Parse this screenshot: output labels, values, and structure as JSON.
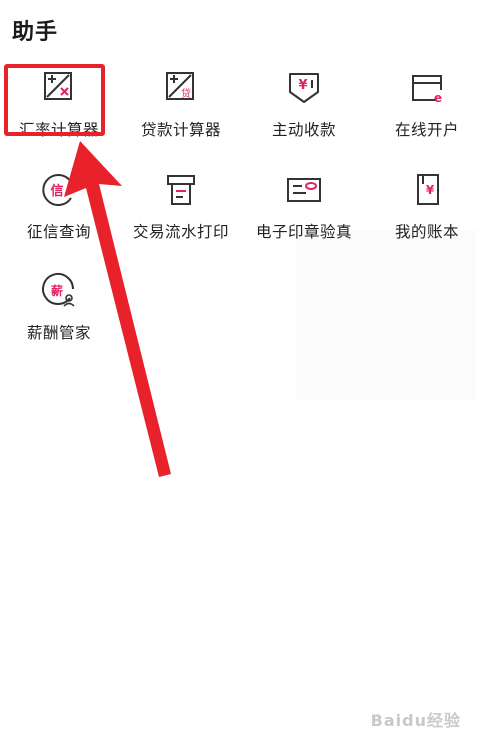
{
  "header": {
    "title": "助手"
  },
  "tools": [
    {
      "label": "汇率计算器",
      "icon": "exchange-rate-calculator-icon"
    },
    {
      "label": "贷款计算器",
      "icon": "loan-calculator-icon"
    },
    {
      "label": "主动收款",
      "icon": "receive-payment-icon"
    },
    {
      "label": "在线开户",
      "icon": "online-account-icon"
    },
    {
      "label": "征信查询",
      "icon": "credit-inquiry-icon"
    },
    {
      "label": "交易流水打印",
      "icon": "transaction-print-icon"
    },
    {
      "label": "电子印章验真",
      "icon": "e-seal-verify-icon"
    },
    {
      "label": "我的账本",
      "icon": "my-ledger-icon"
    },
    {
      "label": "薪酬管家",
      "icon": "salary-manager-icon"
    }
  ],
  "icon_glyphs": {
    "credit": "信",
    "salary": "薪",
    "yen": "¥",
    "e": "e",
    "loan": "贷"
  },
  "watermark": "Baidu经验",
  "colors": {
    "accent": "#e8212a",
    "icon_stroke": "#333333",
    "icon_accent": "#e0245e"
  }
}
